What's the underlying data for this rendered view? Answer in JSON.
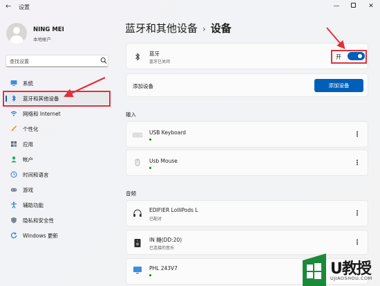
{
  "window": {
    "title": "设置"
  },
  "user": {
    "name": "NING MEI",
    "account_type": "本地帐户"
  },
  "search": {
    "placeholder": "查找设置"
  },
  "sidebar": {
    "items": [
      {
        "label": "系统",
        "icon": "monitor-icon",
        "active": false
      },
      {
        "label": "蓝牙和其他设备",
        "icon": "bluetooth-icon",
        "active": true
      },
      {
        "label": "网络和 Internet",
        "icon": "wifi-icon",
        "active": false
      },
      {
        "label": "个性化",
        "icon": "brush-icon",
        "active": false
      },
      {
        "label": "应用",
        "icon": "apps-icon",
        "active": false
      },
      {
        "label": "帐户",
        "icon": "person-icon",
        "active": false
      },
      {
        "label": "时间和语言",
        "icon": "globe-clock-icon",
        "active": false
      },
      {
        "label": "游戏",
        "icon": "gamepad-icon",
        "active": false
      },
      {
        "label": "辅助功能",
        "icon": "accessibility-icon",
        "active": false
      },
      {
        "label": "隐私和安全性",
        "icon": "shield-icon",
        "active": false
      },
      {
        "label": "Windows 更新",
        "icon": "update-icon",
        "active": false
      }
    ]
  },
  "main": {
    "breadcrumb_parent": "蓝牙和其他设备",
    "breadcrumb_sep": "›",
    "breadcrumb_current": "设备",
    "bluetooth": {
      "title": "蓝牙",
      "status": "蓝牙已关闭",
      "toggle_label": "开",
      "toggle_on": true
    },
    "add_device": {
      "label": "添加设备",
      "button": "添加设备"
    },
    "input_section": "输入",
    "input_devices": [
      {
        "name": "USB Keyboard",
        "icon": "keyboard-icon",
        "status_dot": true
      },
      {
        "name": "Usb Mouse",
        "icon": "mouse-icon",
        "status_dot": true
      }
    ],
    "audio_section": "音频",
    "audio_devices": [
      {
        "name": "EDIFIER LolliPods L",
        "status": "已配对",
        "icon": "headphones-icon"
      },
      {
        "name": "IN 糖(DD:20)",
        "status": "已连接的音乐",
        "icon": "speaker-icon"
      },
      {
        "name": "PHL 243V7",
        "icon": "display-icon",
        "status_dot": true
      }
    ]
  },
  "watermark": {
    "brand": "U教授",
    "url": "UJIAOSHOU.COM"
  },
  "colors": {
    "accent": "#005fb8",
    "annotation_red": "#e0303a",
    "status_green": "#0f7b0f"
  }
}
